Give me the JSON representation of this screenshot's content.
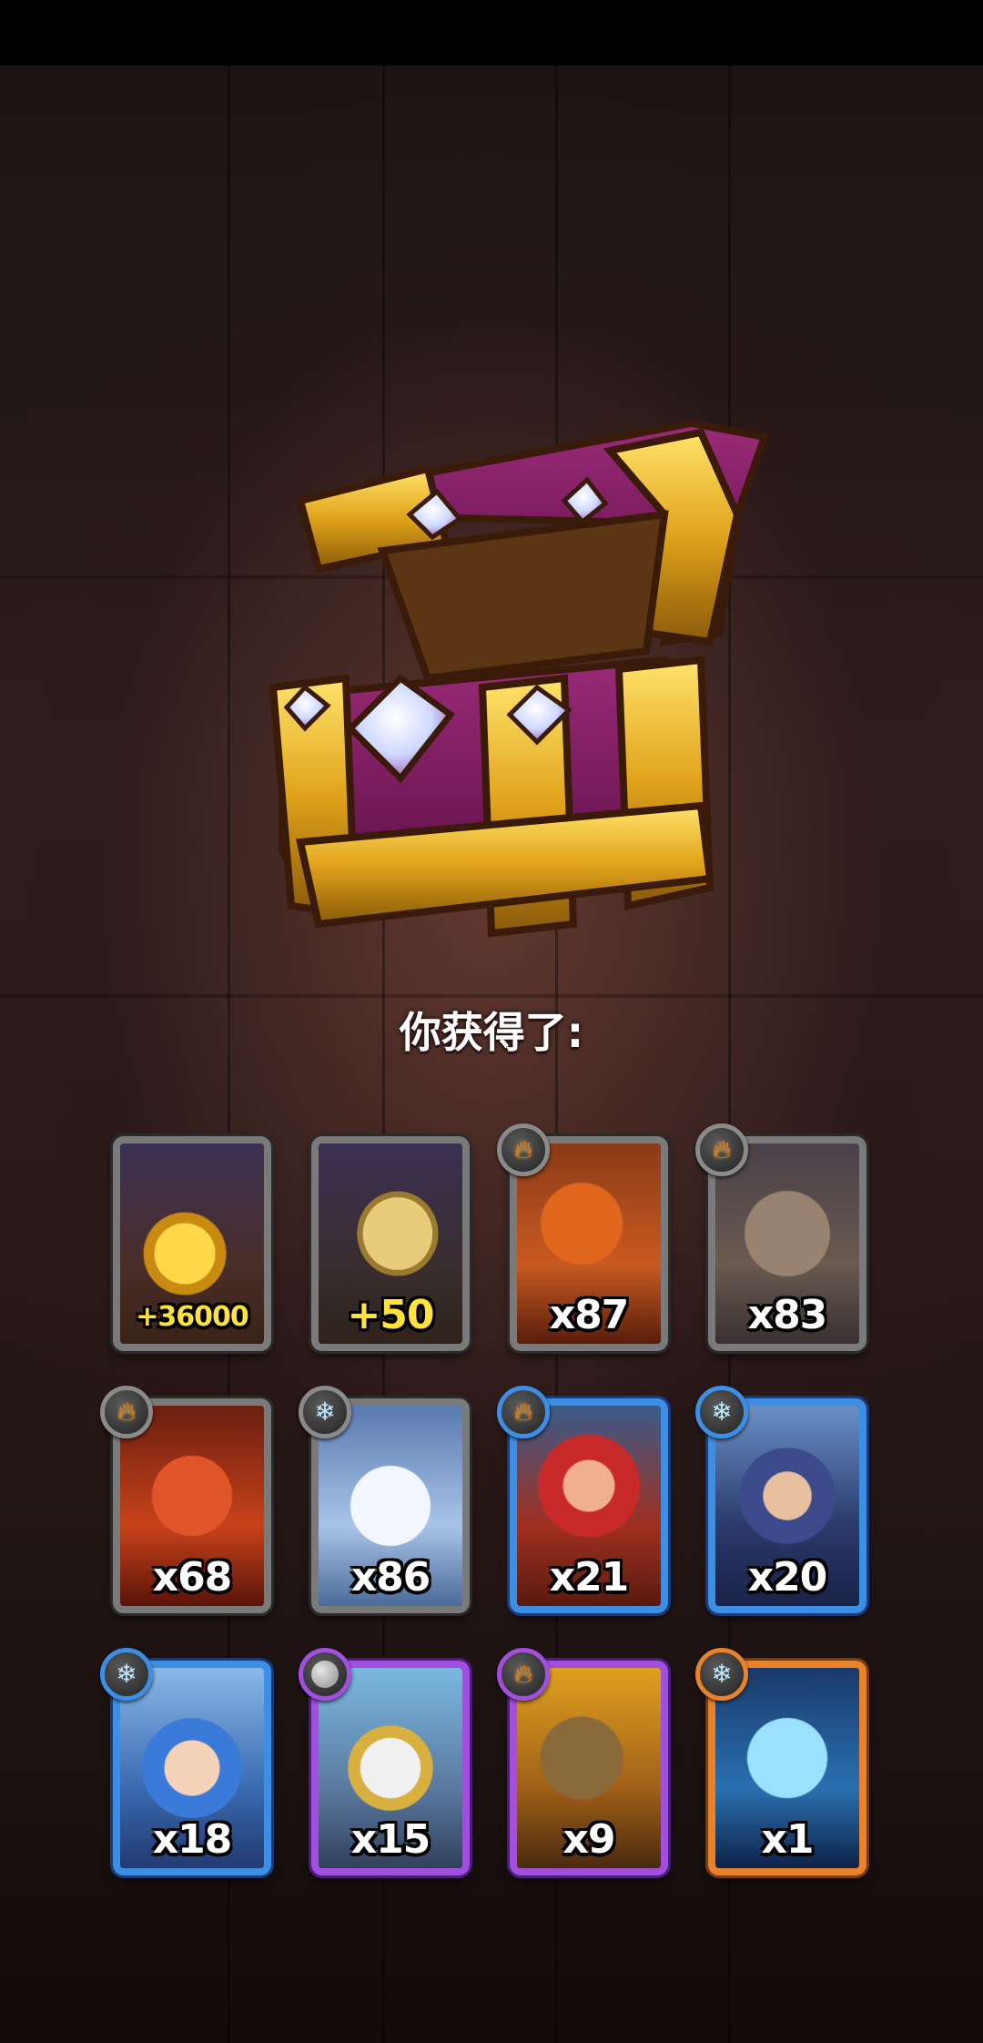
{
  "reward_title": "你获得了:",
  "rewards": [
    {
      "kind": "gold",
      "rarity": "grey",
      "amount": "+36000",
      "element": null
    },
    {
      "kind": "scroll",
      "rarity": "grey",
      "amount": "+50",
      "element": null
    },
    {
      "kind": "hero-dragon",
      "rarity": "grey",
      "amount": "x87",
      "element": "fire"
    },
    {
      "kind": "hero-golem",
      "rarity": "grey",
      "amount": "x83",
      "element": "fire"
    },
    {
      "kind": "hero-fox",
      "rarity": "grey",
      "amount": "x68",
      "element": "fire"
    },
    {
      "kind": "hero-snowman",
      "rarity": "grey",
      "amount": "x86",
      "element": "ice"
    },
    {
      "kind": "hero-red-hood",
      "rarity": "blue",
      "amount": "x21",
      "element": "fire"
    },
    {
      "kind": "hero-elf",
      "rarity": "blue",
      "amount": "x20",
      "element": "ice"
    },
    {
      "kind": "hero-girl",
      "rarity": "blue",
      "amount": "x18",
      "element": "ice"
    },
    {
      "kind": "hero-griffin",
      "rarity": "purple",
      "amount": "x15",
      "element": "moon"
    },
    {
      "kind": "hero-treant",
      "rarity": "purple",
      "amount": "x9",
      "element": "fire"
    },
    {
      "kind": "hero-ice-dragon",
      "rarity": "orange",
      "amount": "x1",
      "element": "ice"
    }
  ],
  "colors": {
    "grey": "#7a7a7a",
    "blue": "#3d8fe6",
    "purple": "#a24fe0",
    "orange": "#e8822b",
    "gold_text": "#ffe23a"
  }
}
